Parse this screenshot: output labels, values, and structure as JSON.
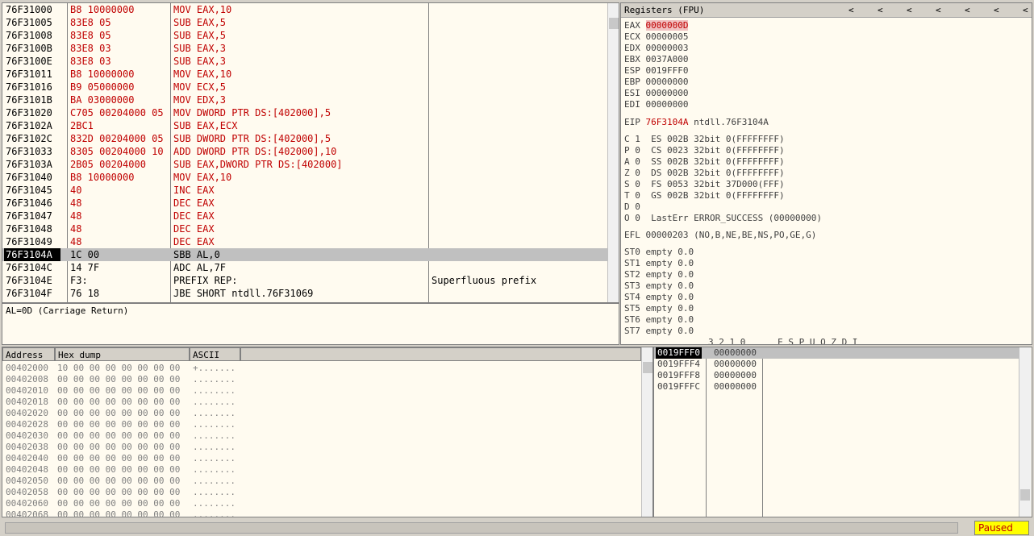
{
  "cpu": {
    "rows": [
      {
        "addr": "76F31000",
        "hex": "B8 10000000",
        "dis": "MOV EAX,10",
        "cmt": ""
      },
      {
        "addr": "76F31005",
        "hex": "83E8 05",
        "dis": "SUB EAX,5",
        "cmt": ""
      },
      {
        "addr": "76F31008",
        "hex": "83E8 05",
        "dis": "SUB EAX,5",
        "cmt": ""
      },
      {
        "addr": "76F3100B",
        "hex": "83E8 03",
        "dis": "SUB EAX,3",
        "cmt": ""
      },
      {
        "addr": "76F3100E",
        "hex": "83E8 03",
        "dis": "SUB EAX,3",
        "cmt": ""
      },
      {
        "addr": "76F31011",
        "hex": "B8 10000000",
        "dis": "MOV EAX,10",
        "cmt": ""
      },
      {
        "addr": "76F31016",
        "hex": "B9 05000000",
        "dis": "MOV ECX,5",
        "cmt": ""
      },
      {
        "addr": "76F3101B",
        "hex": "BA 03000000",
        "dis": "MOV EDX,3",
        "cmt": ""
      },
      {
        "addr": "76F31020",
        "hex": "C705 00204000 05",
        "dis": "MOV DWORD PTR DS:[402000],5",
        "cmt": ""
      },
      {
        "addr": "76F3102A",
        "hex": "2BC1",
        "dis": "SUB EAX,ECX",
        "cmt": ""
      },
      {
        "addr": "76F3102C",
        "hex": "832D 00204000 05",
        "dis": "SUB DWORD PTR DS:[402000],5",
        "cmt": ""
      },
      {
        "addr": "76F31033",
        "hex": "8305 00204000 10",
        "dis": "ADD DWORD PTR DS:[402000],10",
        "cmt": ""
      },
      {
        "addr": "76F3103A",
        "hex": "2B05 00204000",
        "dis": "SUB EAX,DWORD PTR DS:[402000]",
        "cmt": ""
      },
      {
        "addr": "76F31040",
        "hex": "B8 10000000",
        "dis": "MOV EAX,10",
        "cmt": ""
      },
      {
        "addr": "76F31045",
        "hex": "40",
        "dis": "INC EAX",
        "cmt": ""
      },
      {
        "addr": "76F31046",
        "hex": "48",
        "dis": "DEC EAX",
        "cmt": ""
      },
      {
        "addr": "76F31047",
        "hex": "48",
        "dis": "DEC EAX",
        "cmt": ""
      },
      {
        "addr": "76F31048",
        "hex": "48",
        "dis": "DEC EAX",
        "cmt": ""
      },
      {
        "addr": "76F31049",
        "hex": "48",
        "dis": "DEC EAX",
        "cmt": ""
      },
      {
        "addr": "76F3104A",
        "hex": "1C 00",
        "dis": "SBB AL,0",
        "cmt": ""
      },
      {
        "addr": "76F3104C",
        "hex": "14 7F",
        "dis": "ADC AL,7F",
        "cmt": ""
      },
      {
        "addr": "76F3104E",
        "hex": "F3:",
        "dis": "PREFIX REP:",
        "cmt": "Superfluous prefix"
      },
      {
        "addr": "76F3104F",
        "hex": "76 18",
        "dis": "JBE SHORT ntdll.76F31069",
        "cmt": ""
      }
    ],
    "selected_index": 19
  },
  "info": {
    "text": "AL=0D (Carriage Return)"
  },
  "registers": {
    "title": "Registers (FPU)",
    "arrows": [
      "<",
      "<",
      "<",
      "<",
      "<",
      "<",
      "<"
    ],
    "gp": [
      {
        "name": "EAX",
        "value": "0000000D"
      },
      {
        "name": "ECX",
        "value": "00000005"
      },
      {
        "name": "EDX",
        "value": "00000003"
      },
      {
        "name": "EBX",
        "value": "0037A000"
      },
      {
        "name": "ESP",
        "value": "0019FFF0"
      },
      {
        "name": "EBP",
        "value": "00000000"
      },
      {
        "name": "ESI",
        "value": "00000000"
      },
      {
        "name": "EDI",
        "value": "00000000"
      }
    ],
    "eip": {
      "name": "EIP",
      "value": "76F3104A",
      "text": "ntdll.76F3104A"
    },
    "flags": [
      "C 1  ES 002B 32bit 0(FFFFFFFF)",
      "P 0  CS 0023 32bit 0(FFFFFFFF)",
      "A 0  SS 002B 32bit 0(FFFFFFFF)",
      "Z 0  DS 002B 32bit 0(FFFFFFFF)",
      "S 0  FS 0053 32bit 37D000(FFF)",
      "T 0  GS 002B 32bit 0(FFFFFFFF)",
      "D 0",
      "O 0  LastErr ERROR_SUCCESS (00000000)"
    ],
    "efl": "EFL 00000203 (NO,B,NE,BE,NS,PO,GE,G)",
    "fpu": [
      "ST0 empty 0.0",
      "ST1 empty 0.0",
      "ST2 empty 0.0",
      "ST3 empty 0.0",
      "ST4 empty 0.0",
      "ST5 empty 0.0",
      "ST6 empty 0.0",
      "ST7 empty 0.0"
    ],
    "footer": "3 2 1 0      E S P U O Z D I"
  },
  "dump": {
    "headers": [
      "Address",
      "Hex dump",
      "ASCII"
    ],
    "rows": [
      {
        "addr": "00402000",
        "hex": "10 00 00 00 00 00 00 00",
        "ascii": "+......."
      },
      {
        "addr": "00402008",
        "hex": "00 00 00 00 00 00 00 00",
        "ascii": "........"
      },
      {
        "addr": "00402010",
        "hex": "00 00 00 00 00 00 00 00",
        "ascii": "........"
      },
      {
        "addr": "00402018",
        "hex": "00 00 00 00 00 00 00 00",
        "ascii": "........"
      },
      {
        "addr": "00402020",
        "hex": "00 00 00 00 00 00 00 00",
        "ascii": "........"
      },
      {
        "addr": "00402028",
        "hex": "00 00 00 00 00 00 00 00",
        "ascii": "........"
      },
      {
        "addr": "00402030",
        "hex": "00 00 00 00 00 00 00 00",
        "ascii": "........"
      },
      {
        "addr": "00402038",
        "hex": "00 00 00 00 00 00 00 00",
        "ascii": "........"
      },
      {
        "addr": "00402040",
        "hex": "00 00 00 00 00 00 00 00",
        "ascii": "........"
      },
      {
        "addr": "00402048",
        "hex": "00 00 00 00 00 00 00 00",
        "ascii": "........"
      },
      {
        "addr": "00402050",
        "hex": "00 00 00 00 00 00 00 00",
        "ascii": "........"
      },
      {
        "addr": "00402058",
        "hex": "00 00 00 00 00 00 00 00",
        "ascii": "........"
      },
      {
        "addr": "00402060",
        "hex": "00 00 00 00 00 00 00 00",
        "ascii": "........"
      },
      {
        "addr": "00402068",
        "hex": "00 00 00 00 00 00 00 00",
        "ascii": "........"
      }
    ]
  },
  "stack": {
    "rows": [
      {
        "addr": "0019FFF0",
        "value": "00000000"
      },
      {
        "addr": "0019FFF4",
        "value": "00000000"
      },
      {
        "addr": "0019FFF8",
        "value": "00000000"
      },
      {
        "addr": "0019FFFC",
        "value": "00000000"
      }
    ],
    "selected_index": 0
  },
  "status": {
    "state": "Paused",
    "state_color": "#ffff00"
  }
}
